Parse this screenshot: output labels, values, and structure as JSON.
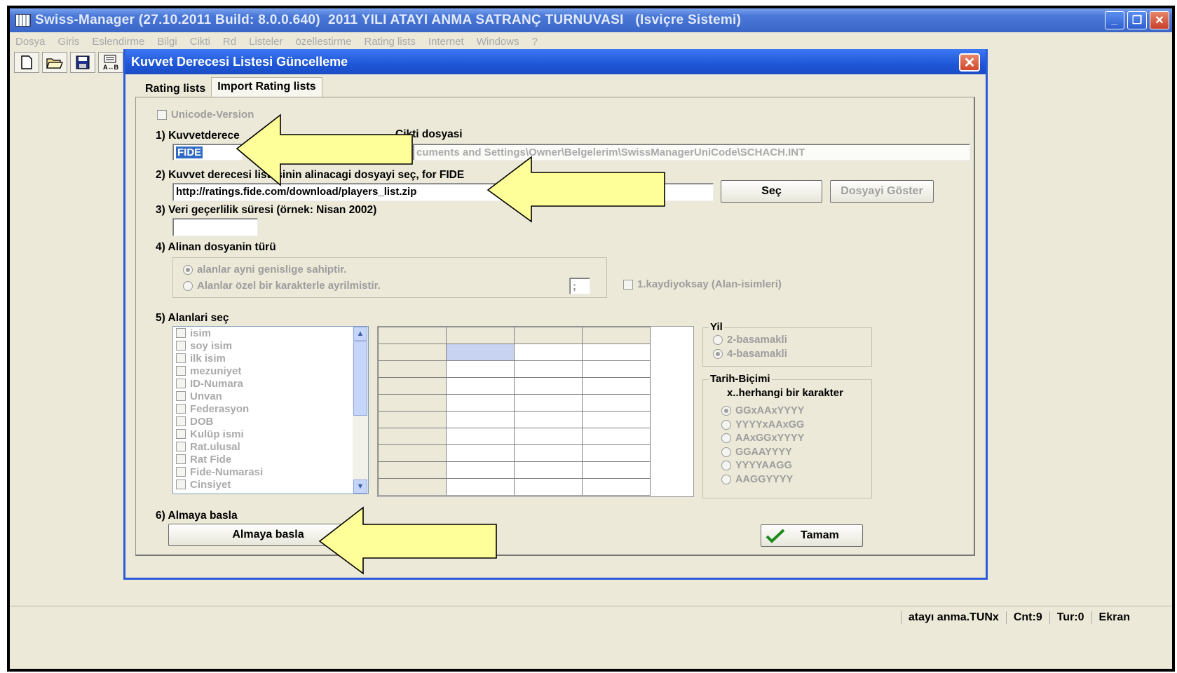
{
  "app": {
    "title": "Swiss-Manager (27.10.2011 Build: 8.0.0.640)  2011 YILI ATAYI ANMA SATRANÇ TURNUVASI   (Isviçre Sistemi)",
    "menu": [
      "Dosya",
      "Giris",
      "Eslendirme",
      "Bilgi",
      "Cikti",
      "Rd",
      "Listeler",
      "özellestirme",
      "Rating lists",
      "Internet",
      "Windows",
      "?"
    ],
    "toolbar_icons": [
      "new-file-icon",
      "open-folder-icon",
      "save-disk-icon",
      "pairing-icon"
    ]
  },
  "dialog": {
    "title": "Kuvvet Derecesi Listesi Güncelleme",
    "tabs": [
      "Rating lists",
      "Import Rating lists"
    ],
    "active_tab": "Import Rating lists",
    "unicode_label": "Unicode-Version",
    "step1": {
      "label_left": "1) Kuvvetderece",
      "label_right": "Cikti dosyasi",
      "value_selected": "FIDE",
      "path_fragment": "cuments and Settings\\Owner\\Belgelerim\\SwissManagerUniCode\\SCHACH.INT"
    },
    "step2": {
      "label": "2) Kuvvet derecesi listesinin alinacagi dosyayi seç, for FIDE",
      "url": "http://ratings.fide.com/download/players_list.zip",
      "select_button": "Seç",
      "show_button": "Dosyayi Göster"
    },
    "step3": {
      "label": "3) Veri geçerlilik süresi (örnek: Nisan 2002)",
      "value": ""
    },
    "step4": {
      "label": "4) Alinan dosyanin türü",
      "option_fixed": "alanlar ayni genislige sahiptir.",
      "option_delimited": "Alanlar özel bir karakterle ayrilmistir.",
      "delimiter": ";",
      "ignore_first_label": "1.kaydiyoksay (Alan-isimleri)"
    },
    "step5": {
      "label": "5) Alanlari seç",
      "fields": [
        "isim",
        "soy isim",
        "ilk isim",
        "mezuniyet",
        "ID-Numara",
        "Unvan",
        "Federasyon",
        "DOB",
        "Kulüp ismi",
        "Rat.ulusal",
        "Rat Fide",
        "Fide-Numarasi",
        "Cinsiyet"
      ]
    },
    "year_group": {
      "legend": "Yil",
      "options": [
        "2-basamakli",
        "4-basamakli"
      ],
      "selected": 1
    },
    "date_group": {
      "legend": "Tarih-Biçimi",
      "hint": "x..herhangi bir karakter",
      "options": [
        "GGxAAxYYYY",
        "YYYYxAAxGG",
        "AAxGGxYYYY",
        "GGAAYYYY",
        "YYYYAAGG",
        "AAGGYYYY"
      ],
      "selected": 0
    },
    "step6": {
      "label": "6) Almaya basla",
      "start_button": "Almaya basla"
    },
    "ok_button": "Tamam"
  },
  "statusbar": {
    "file": "atayı anma.TUNx",
    "count": "Cnt:9",
    "round": "Tur:0",
    "mode": "Ekran"
  }
}
